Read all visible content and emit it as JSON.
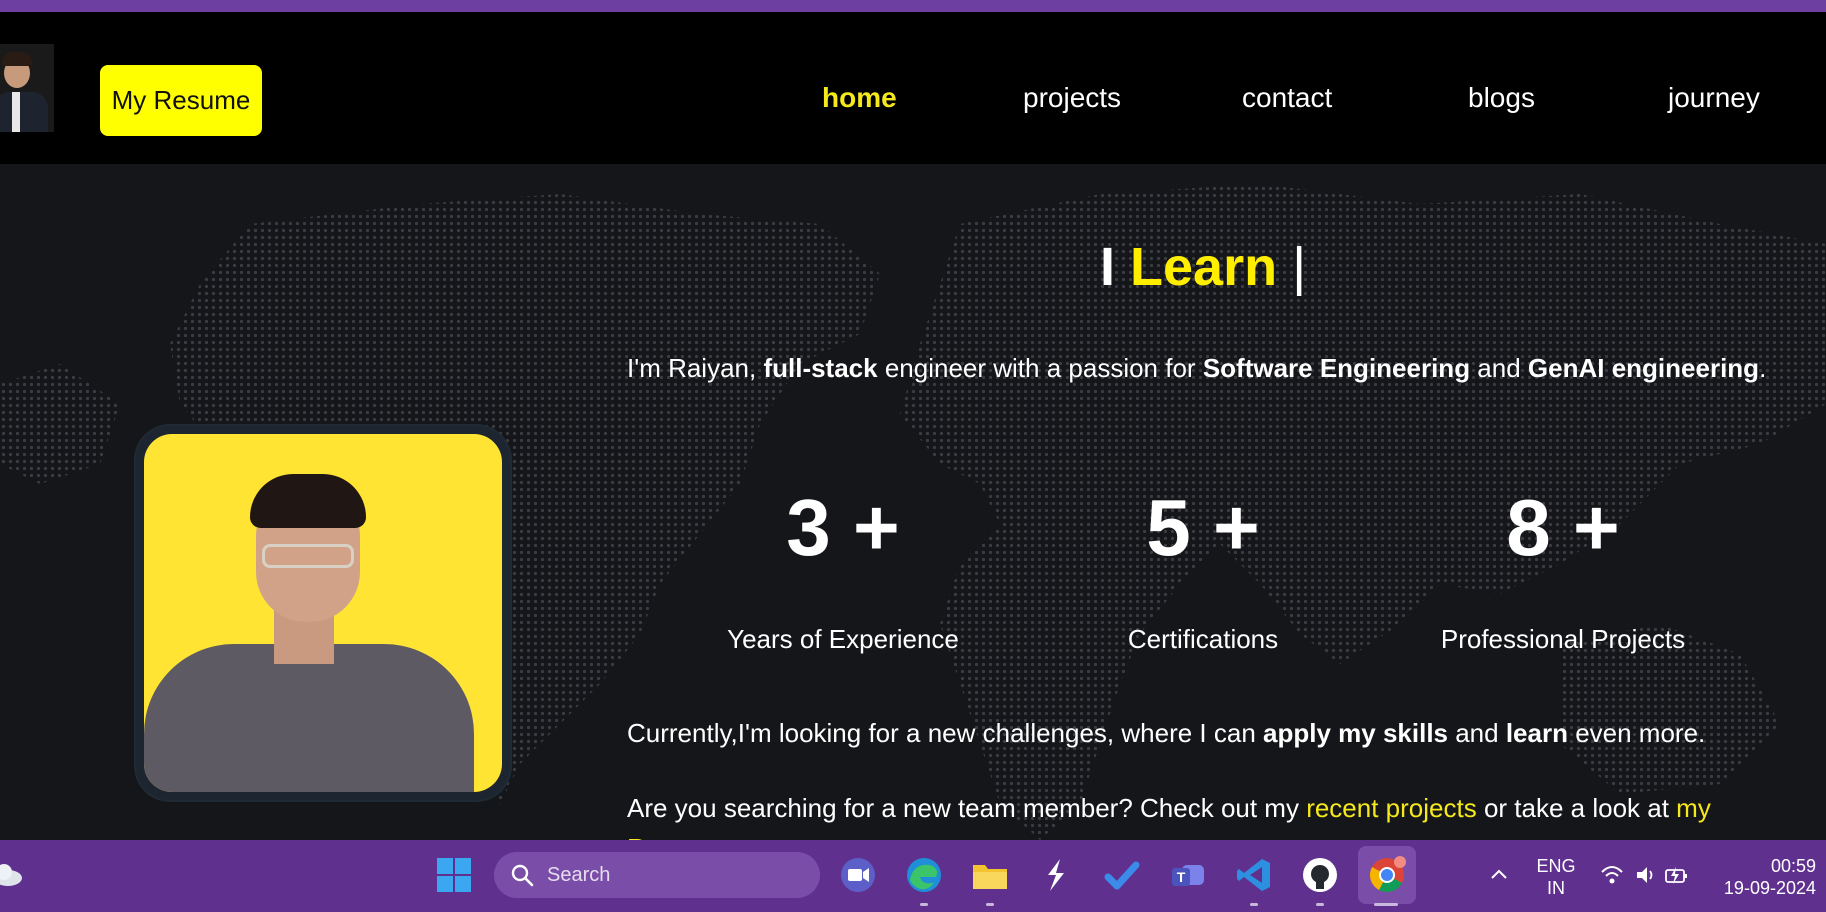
{
  "nav": {
    "resume_label": "My Resume",
    "links": [
      "home",
      "projects",
      "contact",
      "blogs",
      "journey"
    ],
    "active_link": "home"
  },
  "hero": {
    "typed_prefix": "I",
    "typed_word": "Learn",
    "typed_cursor": "|",
    "intro": {
      "t1": "I'm Raiyan, ",
      "b1": "full-stack",
      "t2": " engineer with a passion for ",
      "b2": "Software Engineering",
      "t3": " and ",
      "b3": "GenAI engineering",
      "t4": "."
    },
    "stats": [
      {
        "value": "3 +",
        "label": "Years of Experience"
      },
      {
        "value": "5 +",
        "label": "Certifications"
      },
      {
        "value": "8 +",
        "label": "Professional Projects"
      }
    ],
    "currently": {
      "t1": "Currently,I'm looking for a new challenges, where I can ",
      "b1": "apply my skills",
      "t2": " and ",
      "b2": "learn",
      "t3": " even more."
    },
    "cta": {
      "t1": "Are you searching for a new team member? Check out my ",
      "link1": "recent projects",
      "t2": " or take a look at ",
      "link2": "my Resume",
      "t3": "."
    }
  },
  "taskbar": {
    "search_placeholder": "Search",
    "lang_line1": "ENG",
    "lang_line2": "IN",
    "time": "00:59",
    "date": "19-09-2024",
    "icons": [
      "weather-icon",
      "windows-start-icon",
      "meet-icon",
      "edge-icon",
      "file-explorer-icon",
      "pycharm-icon",
      "todo-icon",
      "teams-icon",
      "vscode-icon",
      "github-icon",
      "chrome-icon",
      "chevron-up-icon",
      "wifi-icon",
      "volume-icon",
      "battery-icon"
    ]
  },
  "colors": {
    "accent_yellow": "#ffee00",
    "taskbar_purple": "#60308f",
    "navbar_bg": "#000000",
    "hero_bg": "#15161a"
  }
}
